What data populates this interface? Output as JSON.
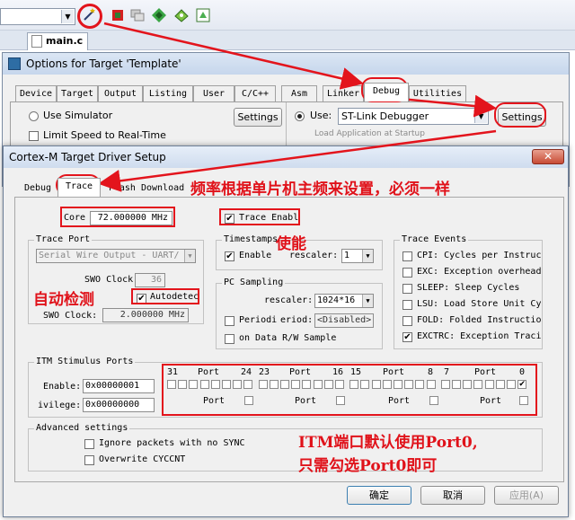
{
  "toolbar": {
    "icons": [
      "target-dropdown",
      "options-for-target-wand",
      "manage-components",
      "batch-build",
      "select-packs",
      "pack-installer",
      "run-time-environment"
    ]
  },
  "editor": {
    "file_tab": "main.c"
  },
  "options_window": {
    "title": "Options for Target 'Template'",
    "tabs": [
      "Device",
      "Target",
      "Output",
      "Listing",
      "User",
      "C/C++",
      "Asm",
      "Linker",
      "Debug",
      "Utilities"
    ],
    "active_tab": "Debug",
    "use_simulator": "Use Simulator",
    "limit_speed": "Limit Speed to Real-Time",
    "settings_left": "Settings",
    "use_label": "Use:",
    "debugger": "ST-Link Debugger",
    "settings_right": "Settings",
    "partial": "Load Application at Startup"
  },
  "dialog": {
    "title": "Cortex-M Target Driver Setup",
    "close": "✕",
    "tabs": [
      "Debug",
      "Trace",
      "Flash Download"
    ],
    "active_tab": "Trace",
    "core_label": "Core",
    "core_value": "72.000000 MHz",
    "trace_enable": "Trace Enabl",
    "trace_port": {
      "title": "Trace Port",
      "port_select": "Serial Wire Output - UART/",
      "swo_clock_prescaler_label": "SWO Clock",
      "swo_clock_prescaler": "36",
      "autodetect": "Autodetec",
      "swo_clock_label": "SWO Clock:",
      "swo_clock_value": "2.000000 MHz"
    },
    "timestamps": {
      "title": "Timestamps",
      "enable": "Enable",
      "prescaler_label": "rescaler:",
      "prescaler_value": "1"
    },
    "pc_sampling": {
      "title": "PC Sampling",
      "prescaler_label": "rescaler:",
      "prescaler_value": "1024*16",
      "periodic": "Periodi",
      "period_label": "eriod:",
      "period_value": "<Disabled>",
      "on_data": "on Data R/W Sample"
    },
    "trace_events": {
      "title": "Trace Events",
      "items": [
        {
          "label": "CPI: Cycles per Instruc",
          "checked": false
        },
        {
          "label": "EXC: Exception overhead",
          "checked": false
        },
        {
          "label": "SLEEP: Sleep Cycles",
          "checked": false
        },
        {
          "label": "LSU: Load Store Unit Cy",
          "checked": false
        },
        {
          "label": "FOLD: Folded Instructio",
          "checked": false
        },
        {
          "label": "EXCTRC: Exception Traci",
          "checked": true
        }
      ]
    },
    "itm": {
      "title": "ITM Stimulus Ports",
      "enable_label": "Enable:",
      "enable_value": "0x00000001",
      "privilege_label": "ivilege:",
      "privilege_value": "0x00000000",
      "header": [
        "31",
        "Port",
        "24",
        "23",
        "Port",
        "16",
        "15",
        "Port",
        "8",
        "7",
        "Port",
        "0"
      ],
      "port_label": "Port",
      "enabled_bits": [
        0
      ]
    },
    "advanced": {
      "title": "Advanced settings",
      "ignore_sync": "Ignore packets with no SYNC",
      "overwrite_cyccnt": "Overwrite CYCCNT"
    },
    "buttons": {
      "ok": "确定",
      "cancel": "取消",
      "apply": "应用(A)"
    }
  },
  "annotations": {
    "frequency_note": "频率根据单片机主频来设置，必须一样",
    "enable_note": "使能",
    "autodetect_note": "自动检测",
    "itm_note_line1": "ITM端口默认使用Port0,",
    "itm_note_line2": "只需勾选Port0即可",
    "color": "#e3141c"
  }
}
